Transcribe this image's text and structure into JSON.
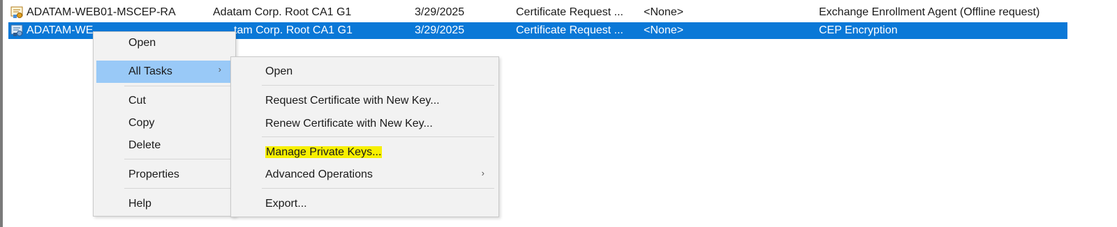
{
  "rows": [
    {
      "icon": "certificate-icon",
      "name": "ADATAM-WEB01-MSCEP-RA",
      "issuer": "Adatam Corp. Root CA1 G1",
      "expiration": "3/29/2025",
      "purposes": "Certificate Request ...",
      "friendly_name": "<None>",
      "template": "Exchange Enrollment Agent (Offline request)",
      "selected": false
    },
    {
      "icon": "certificate-icon",
      "name_visible": "ADATAM-WE",
      "issuer_visible": "tam Corp. Root CA1 G1",
      "expiration": "3/29/2025",
      "purposes": "Certificate Request ...",
      "friendly_name": "<None>",
      "template": "CEP Encryption",
      "selected": true
    }
  ],
  "context_menu": {
    "items": [
      "Open",
      "All Tasks",
      "Cut",
      "Copy",
      "Delete",
      "Properties",
      "Help"
    ],
    "highlighted": "All Tasks",
    "submenu_arrow": "›"
  },
  "submenu": {
    "items": [
      "Open",
      "Request Certificate with New Key...",
      "Renew Certificate with New Key...",
      "Manage Private Keys...",
      "Advanced Operations",
      "Export..."
    ],
    "marker_highlighted": "Manage Private Keys...",
    "submenu_arrow": "›"
  },
  "colors": {
    "selection": "#0a78d7",
    "menu_highlight": "#99c9f7",
    "marker": "#f7f000"
  }
}
